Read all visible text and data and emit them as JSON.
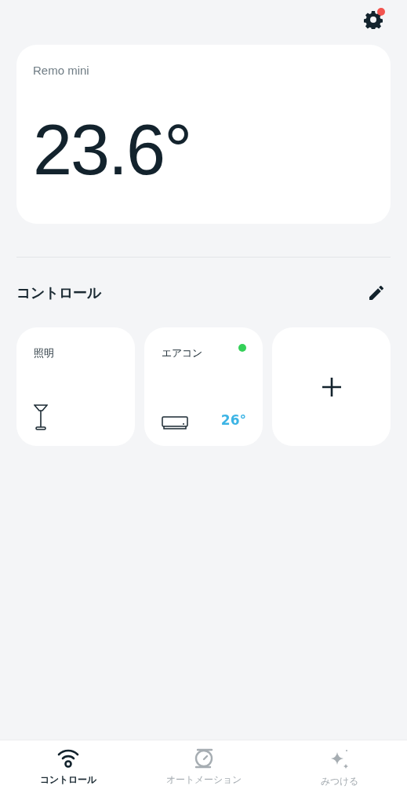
{
  "header": {
    "settings_badge": true
  },
  "device_card": {
    "name": "Remo mini",
    "temperature": "23.6°"
  },
  "section": {
    "title": "コントロール"
  },
  "tiles": [
    {
      "kind": "light",
      "label": "照明"
    },
    {
      "kind": "aircon",
      "label": "エアコン",
      "color": "#34d058",
      "reading": "26°"
    },
    {
      "kind": "add"
    }
  ],
  "tabs": [
    {
      "kind": "control",
      "label": "コントロール",
      "selected": true
    },
    {
      "kind": "automation",
      "label": "オートメーション",
      "selected": false
    },
    {
      "kind": "discover",
      "label": "みつける",
      "selected": false
    }
  ]
}
